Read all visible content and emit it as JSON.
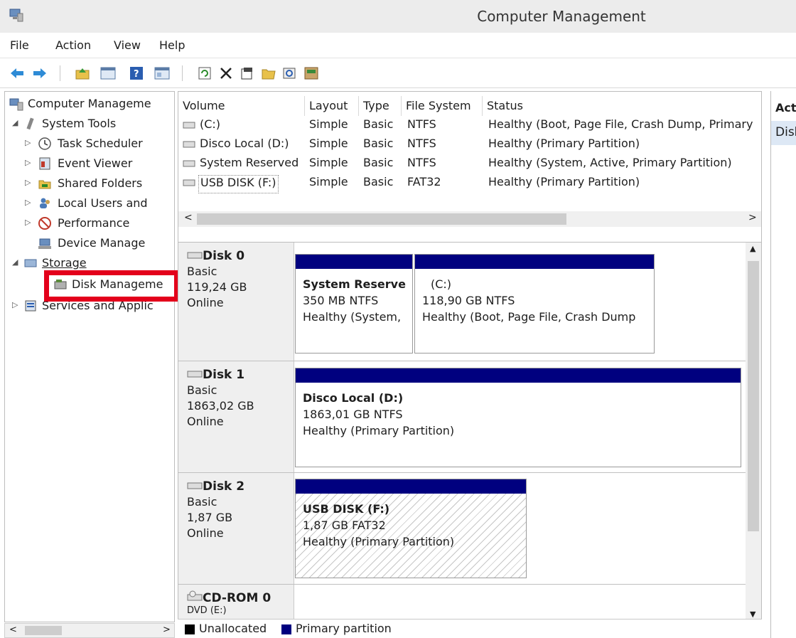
{
  "window": {
    "title": "Computer Management"
  },
  "menu": [
    "File",
    "Action",
    "View",
    "Help"
  ],
  "toolbar": {
    "buttons": [
      "back-arrow-icon",
      "forward-arrow-icon",
      "up-folder-icon",
      "show-hide-tree-icon",
      "help-icon",
      "console-view-icon",
      "refresh-icon",
      "delete-icon",
      "properties-icon",
      "open-folder-icon",
      "search-icon",
      "disk-icon"
    ]
  },
  "tree": {
    "root": "Computer Manageme",
    "system_tools": "System Tools",
    "task_scheduler": "Task Scheduler",
    "event_viewer": "Event Viewer",
    "shared_folders": "Shared Folders",
    "local_users": "Local Users and",
    "performance": "Performance",
    "device_manager": "Device Manage",
    "storage": "Storage",
    "disk_management": "Disk Manageme",
    "services": "Services and Applic"
  },
  "volumes": {
    "headers": [
      "Volume",
      "Layout",
      "Type",
      "File System",
      "Status"
    ],
    "rows": [
      [
        "(C:)",
        "Simple",
        "Basic",
        "NTFS",
        "Healthy (Boot, Page File, Crash Dump, Primary"
      ],
      [
        "Disco Local (D:)",
        "Simple",
        "Basic",
        "NTFS",
        "Healthy (Primary Partition)"
      ],
      [
        "System Reserved",
        "Simple",
        "Basic",
        "NTFS",
        "Healthy (System, Active, Primary Partition)"
      ],
      [
        "USB DISK (F:)",
        "Simple",
        "Basic",
        "FAT32",
        "Healthy (Primary Partition)"
      ]
    ]
  },
  "disks": {
    "disk0": {
      "name": "Disk 0",
      "type": "Basic",
      "size": "119,24 GB",
      "state": "Online",
      "p1": {
        "name": "System Reserve",
        "size": "350 MB NTFS",
        "status": "Healthy (System,"
      },
      "p2": {
        "name": "(C:)",
        "size": "118,90 GB NTFS",
        "status": "Healthy (Boot, Page File, Crash Dump"
      }
    },
    "disk1": {
      "name": "Disk 1",
      "type": "Basic",
      "size": "1863,02 GB",
      "state": "Online",
      "p1": {
        "name": "Disco Local  (D:)",
        "size": "1863,01 GB NTFS",
        "status": "Healthy (Primary Partition)"
      }
    },
    "disk2": {
      "name": "Disk 2",
      "type": "Basic",
      "size": "1,87 GB",
      "state": "Online",
      "p1": {
        "name": "USB DISK  (F:)",
        "size": "1,87 GB FAT32",
        "status": "Healthy (Primary Partition)"
      }
    },
    "cdrom0": {
      "name": "CD-ROM 0",
      "type": "DVD (E:)"
    }
  },
  "legend": {
    "unallocated": "Unallocated",
    "primary": "Primary partition",
    "unallocated_color": "#000000",
    "primary_color": "#00007f"
  },
  "actions": {
    "title": "Actions",
    "item": "Disk Management"
  },
  "colors": {
    "partition_bar": "#00007f",
    "highlight": "#e3001b",
    "selection": "#dde8f5"
  }
}
